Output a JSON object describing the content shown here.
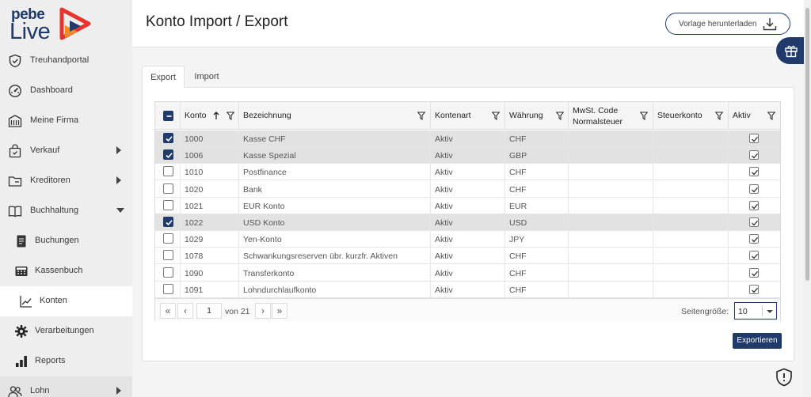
{
  "app": {
    "logo_top": "pebe",
    "logo_bottom": "Live",
    "accent": "#1f3a6b",
    "logo_red": "#e5352e",
    "logo_orange": "#f08a24"
  },
  "sidebar": {
    "items": [
      {
        "label": "Treuhandportal",
        "icon": "shield-check-icon"
      },
      {
        "label": "Dashboard",
        "icon": "gauge-icon"
      },
      {
        "label": "Meine Firma",
        "icon": "building-icon"
      },
      {
        "label": "Verkauf",
        "icon": "shopping-bag-icon"
      },
      {
        "label": "Kreditoren",
        "icon": "folder-icon"
      },
      {
        "label": "Buchhaltung",
        "icon": "book-icon"
      },
      {
        "label": "Buchungen",
        "icon": "document-icon"
      },
      {
        "label": "Kassenbuch",
        "icon": "calculator-icon"
      },
      {
        "label": "Konten",
        "icon": "line-chart-icon"
      },
      {
        "label": "Verarbeitungen",
        "icon": "gear-icon"
      },
      {
        "label": "Reports",
        "icon": "bar-chart-icon"
      },
      {
        "label": "Lohn",
        "icon": "users-icon"
      }
    ]
  },
  "header": {
    "title": "Konto Import / Export",
    "vorlage_label": "Vorlage herunterladen"
  },
  "tabs": {
    "export": "Export",
    "import": "Import"
  },
  "grid": {
    "columns": {
      "konto": "Konto",
      "bezeichnung": "Bezeichnung",
      "kontenart": "Kontenart",
      "waehrung": "Währung",
      "mwst_line1": "MwSt. Code",
      "mwst_line2": "Normalsteuer",
      "steuerkonto": "Steuerkonto",
      "aktiv": "Aktiv"
    },
    "rows": [
      {
        "konto": "1000",
        "bezeichnung": "Kasse CHF",
        "kontenart": "Aktiv",
        "waehrung": "CHF",
        "mwst": "",
        "steuerkonto": ""
      },
      {
        "konto": "1006",
        "bezeichnung": "Kasse Spezial",
        "kontenart": "Aktiv",
        "waehrung": "GBP",
        "mwst": "",
        "steuerkonto": ""
      },
      {
        "konto": "1010",
        "bezeichnung": "Postfinance",
        "kontenart": "Aktiv",
        "waehrung": "CHF",
        "mwst": "",
        "steuerkonto": ""
      },
      {
        "konto": "1020",
        "bezeichnung": "Bank",
        "kontenart": "Aktiv",
        "waehrung": "CHF",
        "mwst": "",
        "steuerkonto": ""
      },
      {
        "konto": "1021",
        "bezeichnung": "EUR Konto",
        "kontenart": "Aktiv",
        "waehrung": "EUR",
        "mwst": "",
        "steuerkonto": ""
      },
      {
        "konto": "1022",
        "bezeichnung": "USD Konto",
        "kontenart": "Aktiv",
        "waehrung": "USD",
        "mwst": "",
        "steuerkonto": ""
      },
      {
        "konto": "1029",
        "bezeichnung": "Yen-Konto",
        "kontenart": "Aktiv",
        "waehrung": "JPY",
        "mwst": "",
        "steuerkonto": ""
      },
      {
        "konto": "1078",
        "bezeichnung": "Schwankungsreserven übr. kurzfr. Aktiven",
        "kontenart": "Aktiv",
        "waehrung": "CHF",
        "mwst": "",
        "steuerkonto": ""
      },
      {
        "konto": "1090",
        "bezeichnung": "Transferkonto",
        "kontenart": "Aktiv",
        "waehrung": "CHF",
        "mwst": "",
        "steuerkonto": ""
      },
      {
        "konto": "1091",
        "bezeichnung": "Lohndurchlaufkonto",
        "kontenart": "Aktiv",
        "waehrung": "CHF",
        "mwst": "",
        "steuerkonto": ""
      }
    ],
    "selected_rows": [
      0,
      1,
      5
    ]
  },
  "pager": {
    "page": "1",
    "of_label": "von 21",
    "page_size_label": "Seitengröße:",
    "page_size": "10"
  },
  "actions": {
    "export_label": "Exportieren"
  }
}
